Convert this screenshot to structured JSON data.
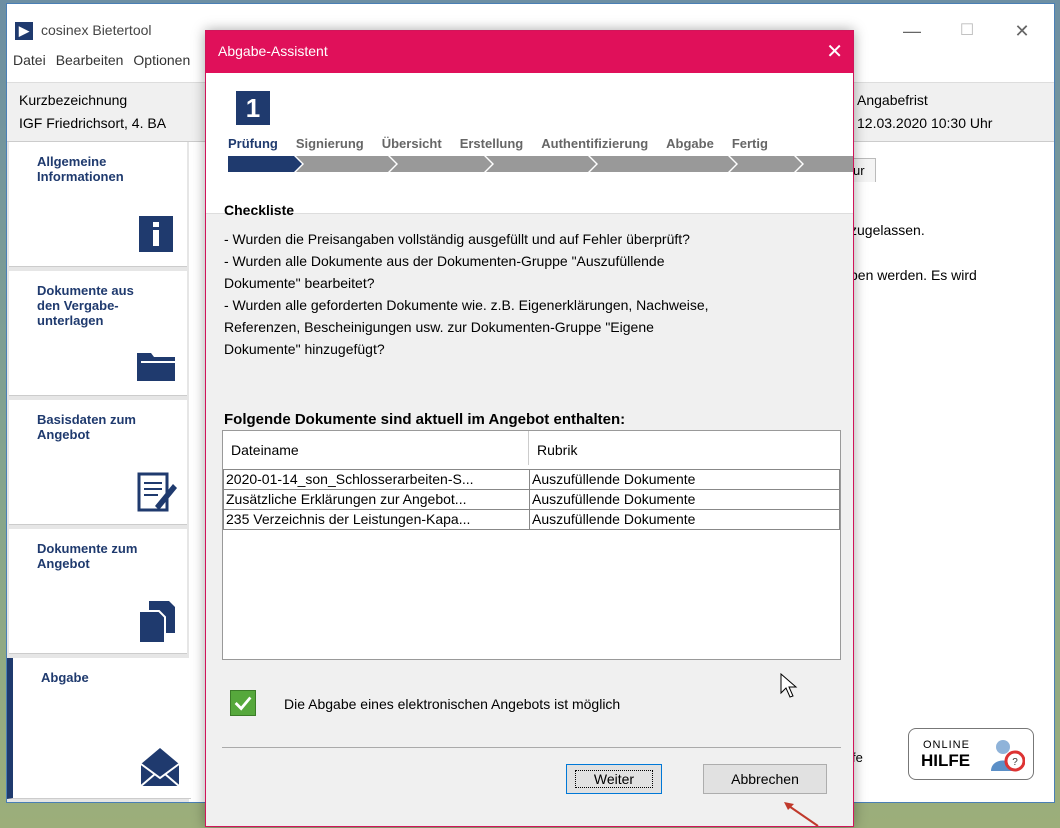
{
  "app": {
    "title": "cosinex Bietertool",
    "logo_glyph": "▶"
  },
  "menu": [
    "Datei",
    "Bearbeiten",
    "Optionen"
  ],
  "window_controls": {
    "minimize": "—",
    "maximize": "☐",
    "close": "✕"
  },
  "info": {
    "label": "Kurzbezeichnung",
    "value": "IGF Friedrichsort, 4. BA",
    "frist_label": "Angabefrist",
    "frist_value": "12.03.2020 10:30 Uhr"
  },
  "sidebar": [
    {
      "label": "Allgemeine Informationen",
      "icon": "info-icon"
    },
    {
      "label": "Dokumente aus den Vergabe-unterlagen",
      "icon": "folder-icon"
    },
    {
      "label": "Basisdaten zum Angebot",
      "icon": "edit-document-icon"
    },
    {
      "label": "Dokumente zum Angebot",
      "icon": "documents-icon"
    },
    {
      "label": "Abgabe",
      "icon": "envelope-icon"
    }
  ],
  "content": {
    "tab_fragment": "ur",
    "text1": "zugelassen.",
    "text2": "ben werden. Es wird",
    "help_fragment": "fe",
    "online_help": {
      "line1": "ONLINE",
      "line2": "HILFE"
    }
  },
  "dialog": {
    "title": "Abgabe-Assistent",
    "close": "✕",
    "step_number": "1",
    "steps": [
      "Prüfung",
      "Signierung",
      "Übersicht",
      "Erstellung",
      "Authentifizierung",
      "Abgabe",
      "Fertig"
    ],
    "checklist_title": "Checkliste",
    "checklist_text": "- Wurden die Preisangaben vollständig ausgefüllt und auf Fehler überprüft?\n- Wurden alle Dokumente aus der Dokumenten-Gruppe \"Auszufüllende\nDokumente\" bearbeitet?\n- Wurden alle geforderten Dokumente wie. z.B. Eigenerklärungen, Nachweise,\nReferenzen, Bescheinigungen usw. zur Dokumenten-Gruppe \"Eigene\nDokumente\" hinzugefügt?",
    "docs_title": "Folgende Dokumente sind aktuell im Angebot enthalten:",
    "table": {
      "headers": [
        "Dateiname",
        "Rubrik"
      ],
      "rows": [
        [
          "2020-01-14_son_Schlosserarbeiten-S...",
          "Auszufüllende Dokumente"
        ],
        [
          "Zusätzliche Erklärungen zur Angebot...",
          "Auszufüllende Dokumente"
        ],
        [
          "235 Verzeichnis der Leistungen-Kapa...",
          "Auszufüllende Dokumente"
        ]
      ]
    },
    "status_text": "Die Abgabe eines elektronischen Angebots ist möglich",
    "buttons": {
      "next": "Weiter",
      "cancel": "Abbrechen"
    }
  },
  "colors": {
    "accent": "#e0105a",
    "navy": "#1f3a6e",
    "ok_green": "#56a83c"
  }
}
